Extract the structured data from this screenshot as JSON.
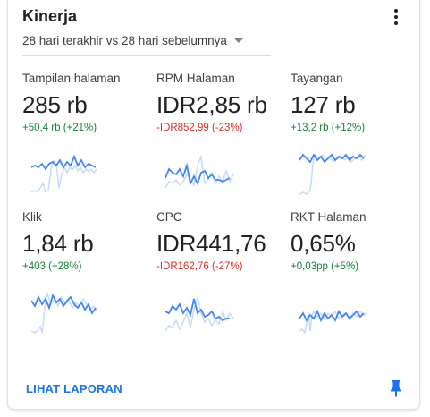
{
  "header": {
    "title": "Kinerja",
    "period_selector": "28 hari terakhir vs 28 hari sebelumnya"
  },
  "colors": {
    "current_line": "#4285f4",
    "previous_line": "#c6dafc",
    "positive": "#188038",
    "negative": "#d93025",
    "link": "#1a73e8"
  },
  "metrics": [
    {
      "label": "Tampilan halaman",
      "value": "285 rb",
      "change": "+50,4 rb (+21%)",
      "trend": "up"
    },
    {
      "label": "RPM Halaman",
      "value": "IDR2,85 rb",
      "change": "-IDR852,99 (-23%)",
      "trend": "down"
    },
    {
      "label": "Tayangan",
      "value": "127 rb",
      "change": "+13,2 rb (+12%)",
      "trend": "up"
    },
    {
      "label": "Klik",
      "value": "1,84 rb",
      "change": "+403 (+28%)",
      "trend": "up"
    },
    {
      "label": "CPC",
      "value": "IDR441,76",
      "change": "-IDR162,76 (-27%)",
      "trend": "down"
    },
    {
      "label": "RKT Halaman",
      "value": "0,65%",
      "change": "+0,03pp (+5%)",
      "trend": "up"
    }
  ],
  "footer": {
    "report_link": "LIHAT LAPORAN",
    "pin_icon": "pin-icon"
  }
}
